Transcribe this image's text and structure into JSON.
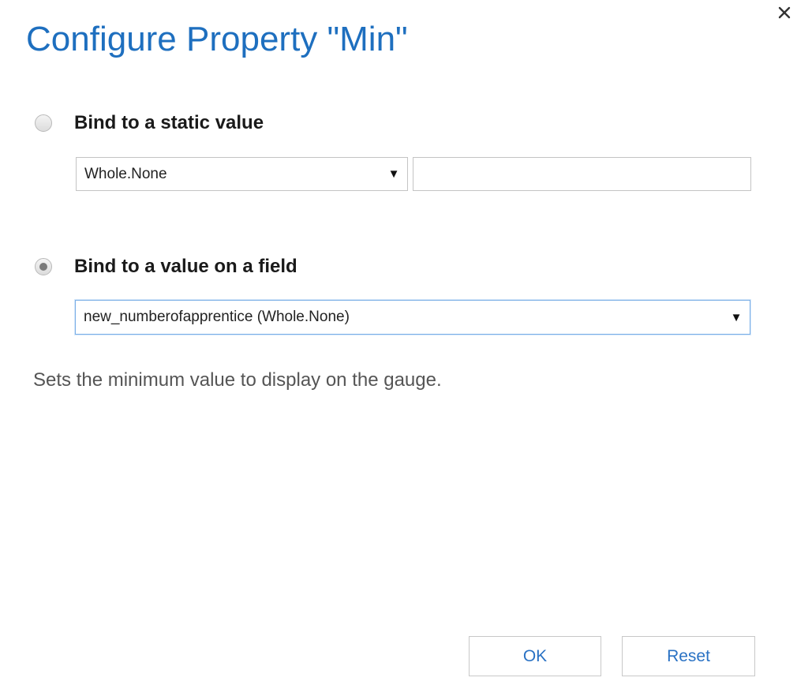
{
  "dialog": {
    "title": "Configure Property \"Min\"",
    "close_icon": "close-icon",
    "accent_color": "#1e6fbf"
  },
  "static_option": {
    "label": "Bind to a static value",
    "selected": false,
    "type_select_value": "Whole.None",
    "value_input": ""
  },
  "field_option": {
    "label": "Bind to a value on a field",
    "selected": true,
    "field_select_value": "new_numberofapprentice (Whole.None)"
  },
  "description": "Sets the minimum value to display on the gauge.",
  "buttons": {
    "ok_label": "OK",
    "reset_label": "Reset"
  }
}
